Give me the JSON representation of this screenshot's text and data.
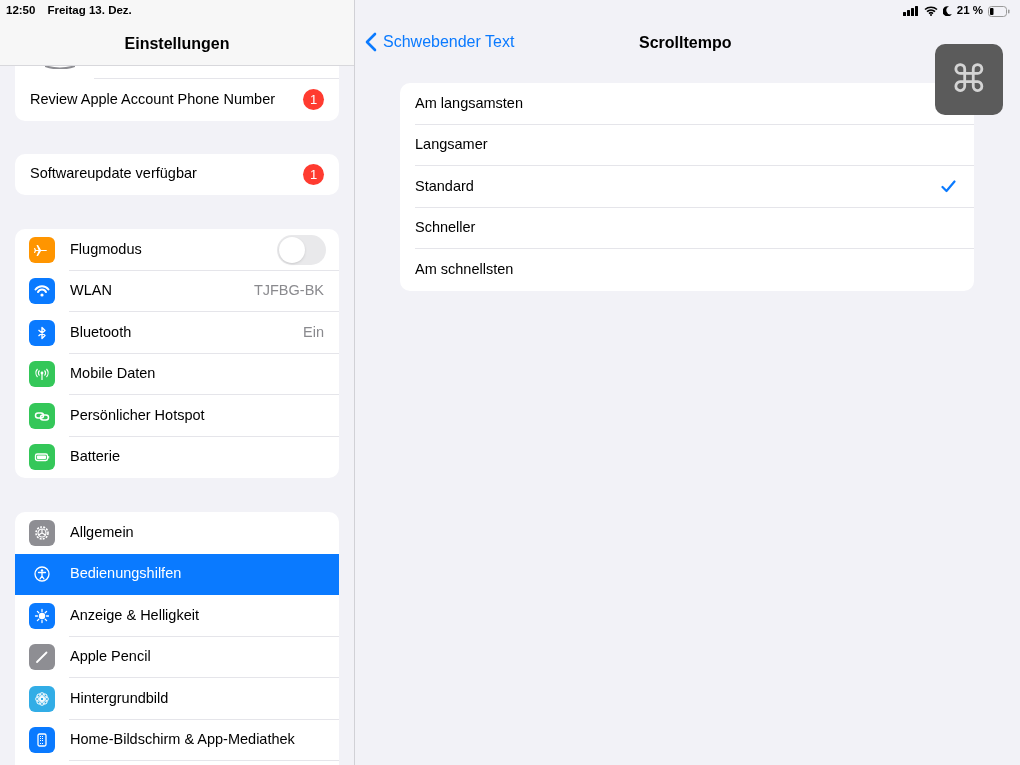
{
  "status_bar": {
    "time": "12:50",
    "date": "Freitag 13. Dez.",
    "battery": "21 %"
  },
  "sidebar": {
    "title": "Einstellungen",
    "groups": [
      {
        "items": [
          {
            "kind": "badge",
            "label": "Review Apple Account Phone Number",
            "badge": "1",
            "selected": false
          }
        ]
      },
      {
        "items": [
          {
            "kind": "badge",
            "label": "Softwareupdate verfügbar",
            "badge": "1",
            "selected": false
          }
        ]
      },
      {
        "items": [
          {
            "kind": "toggle",
            "label": "Flugmodus",
            "on": false,
            "selected": false
          },
          {
            "kind": "value",
            "label": "WLAN",
            "value": "TJFBG-BK",
            "selected": false
          },
          {
            "kind": "value",
            "label": "Bluetooth",
            "value": "Ein",
            "selected": false
          },
          {
            "kind": "plain",
            "label": "Mobile Daten",
            "selected": false
          },
          {
            "kind": "plain",
            "label": "Persönlicher Hotspot",
            "selected": false
          },
          {
            "kind": "plain",
            "label": "Batterie",
            "selected": false
          }
        ]
      },
      {
        "items": [
          {
            "kind": "plain",
            "label": "Allgemein",
            "selected": false
          },
          {
            "kind": "plain",
            "label": "Bedienungshilfen",
            "selected": true
          },
          {
            "kind": "plain",
            "label": "Anzeige & Helligkeit",
            "selected": false
          },
          {
            "kind": "plain",
            "label": "Apple Pencil",
            "selected": false
          },
          {
            "kind": "plain",
            "label": "Hintergrundbild",
            "selected": false
          },
          {
            "kind": "plain",
            "label": "Home-Bildschirm & App-Mediathek",
            "selected": false
          }
        ]
      }
    ]
  },
  "detail": {
    "back": "Schwebender Text",
    "title": "Scrolltempo",
    "options": [
      {
        "label": "Am langsamsten",
        "selected": false
      },
      {
        "label": "Langsamer",
        "selected": false
      },
      {
        "label": "Standard",
        "selected": true
      },
      {
        "label": "Schneller",
        "selected": false
      },
      {
        "label": "Am schnellsten",
        "selected": false
      }
    ]
  },
  "floating_button": {
    "symbol": "⌘"
  }
}
